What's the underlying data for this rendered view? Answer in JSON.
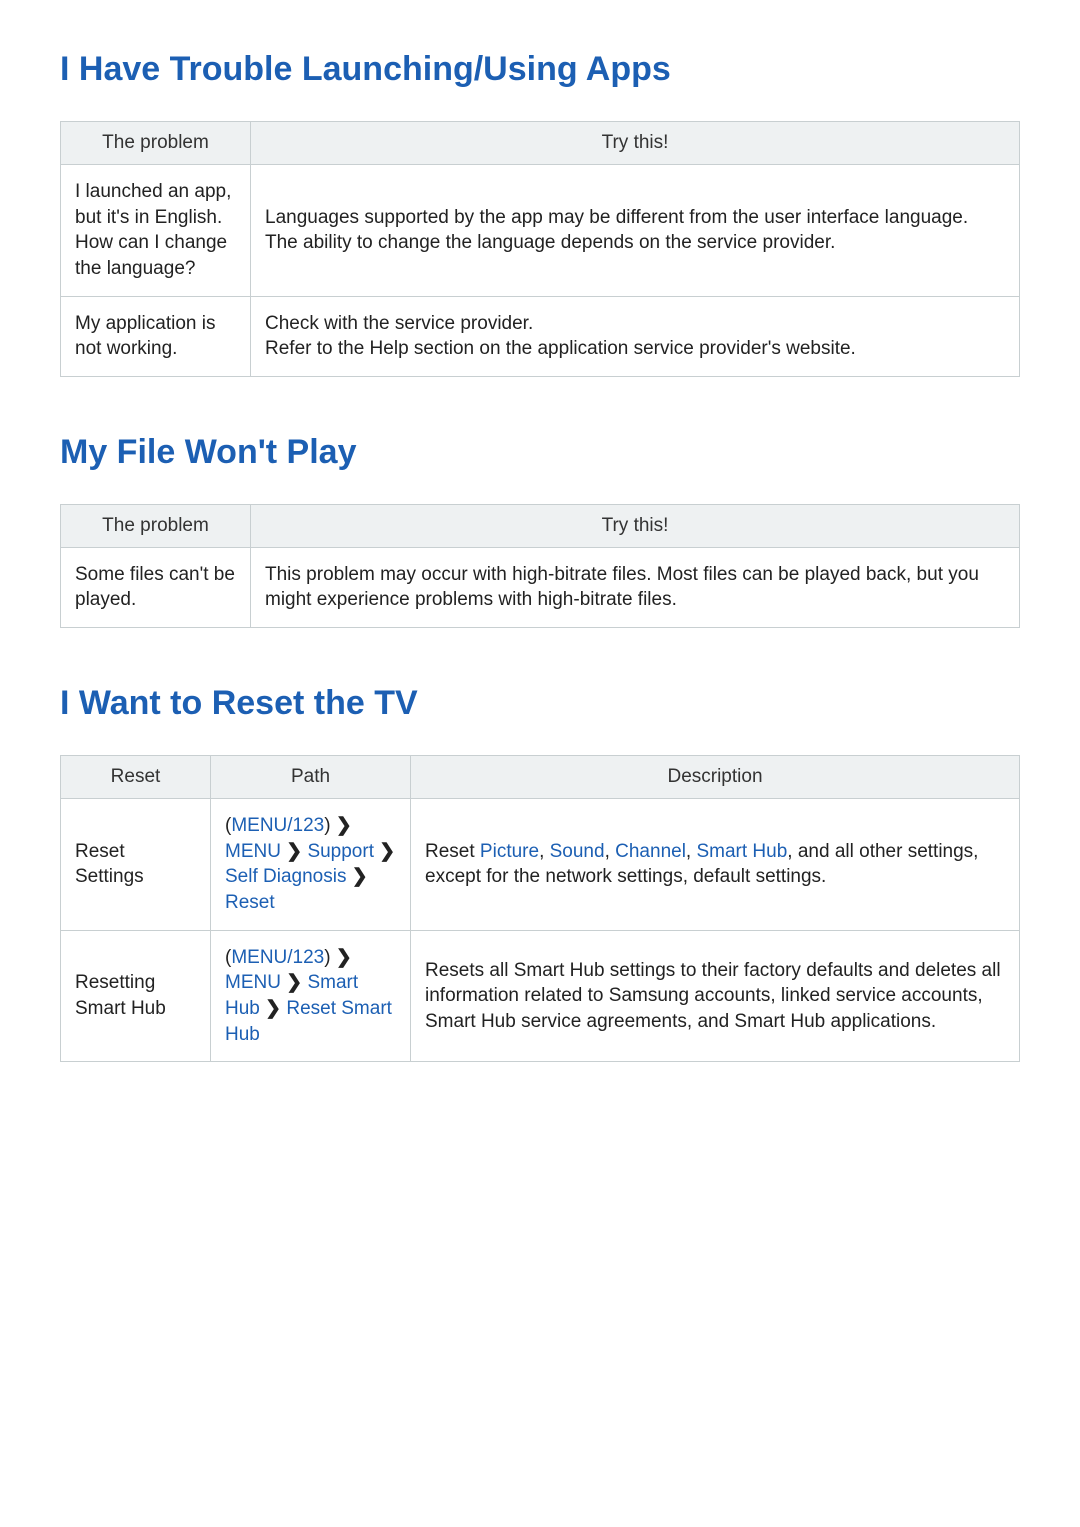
{
  "sections": {
    "apps": {
      "title": "I Have Trouble Launching/Using Apps",
      "headers": {
        "problem": "The problem",
        "try": "Try this!"
      },
      "rows": [
        {
          "problem": "I launched an app, but it's in English. How can I change the language?",
          "try": "Languages supported by the app may be different from the user interface language. The ability to change the language depends on the service provider."
        },
        {
          "problem": "My application is not working.",
          "try": "Check with the service provider.\nRefer to the Help section on the application service provider's website."
        }
      ]
    },
    "file": {
      "title": "My File Won't Play",
      "headers": {
        "problem": "The problem",
        "try": "Try this!"
      },
      "rows": [
        {
          "problem": "Some files can't be played.",
          "try": "This problem may occur with high-bitrate files. Most files can be played back, but you might experience problems with high-bitrate files."
        }
      ]
    },
    "reset": {
      "title": "I Want to Reset the TV",
      "headers": {
        "reset": "Reset",
        "path": "Path",
        "desc": "Description"
      },
      "rows": [
        {
          "reset": "Reset Settings",
          "path": {
            "pre": "(",
            "key": "MENU/123",
            "post": ")",
            "p1": "MENU",
            "p2": "Support",
            "p3": "Self Diagnosis",
            "p4": "Reset"
          },
          "desc": {
            "pre": "Reset ",
            "a1": "Picture",
            "s1": ", ",
            "a2": "Sound",
            "s2": ", ",
            "a3": "Channel",
            "s3": ", ",
            "a4": "Smart Hub",
            "post": ", and all other settings, except for the network settings, default settings."
          }
        },
        {
          "reset": "Resetting Smart Hub",
          "path": {
            "pre": "(",
            "key": "MENU/123",
            "post": ")",
            "p1": "MENU",
            "p2": "Smart Hub",
            "p3": "Reset Smart Hub"
          },
          "desc_plain": "Resets all Smart Hub settings to their factory defaults and deletes all information related to Samsung accounts, linked service accounts, Smart Hub service agreements, and Smart Hub applications."
        }
      ]
    }
  },
  "glyphs": {
    "arrow": "❯"
  }
}
